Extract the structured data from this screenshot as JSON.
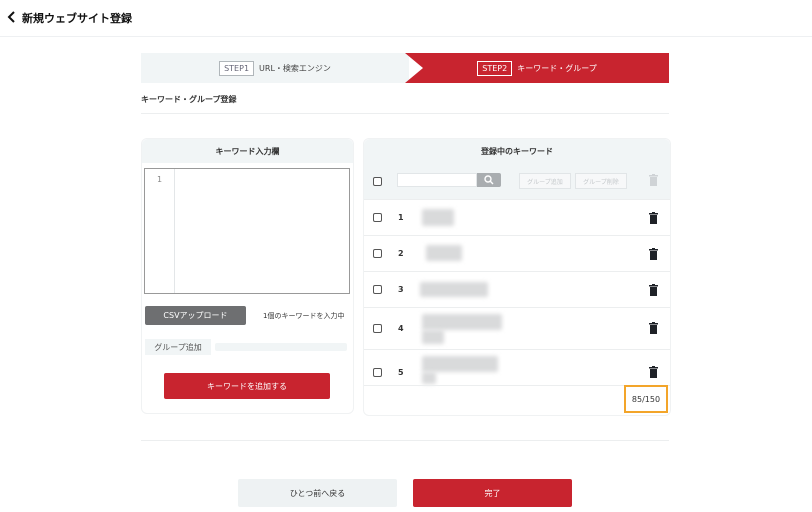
{
  "page": {
    "title": "新規ウェブサイト登録"
  },
  "stepper": {
    "step1": {
      "tag": "STEP1",
      "label": "URL・検索エンジン"
    },
    "step2": {
      "tag": "STEP2",
      "label": "キーワード・グループ"
    }
  },
  "section_title": "キーワード・グループ登録",
  "input_panel": {
    "header": "キーワード入力欄",
    "line_number": "1",
    "csv_button": "CSVアップロード",
    "keyword_count": "1個のキーワードを入力中",
    "group_add_label": "グループ追加",
    "add_button": "キーワードを追加する"
  },
  "registered_panel": {
    "header": "登録中のキーワード",
    "toolbar": {
      "group_add": "グループ追加",
      "group_delete": "グループ削除"
    },
    "rows": [
      {
        "num": "1"
      },
      {
        "num": "2"
      },
      {
        "num": "3"
      },
      {
        "num": "4"
      },
      {
        "num": "5"
      }
    ],
    "limit": "85/150"
  },
  "footer": {
    "back_button": "ひとつ前へ戻る",
    "done_button": "完了"
  },
  "colors": {
    "accent": "#c8242f",
    "highlight": "#f3a52a",
    "panel_bg": "#f1f5f6"
  }
}
